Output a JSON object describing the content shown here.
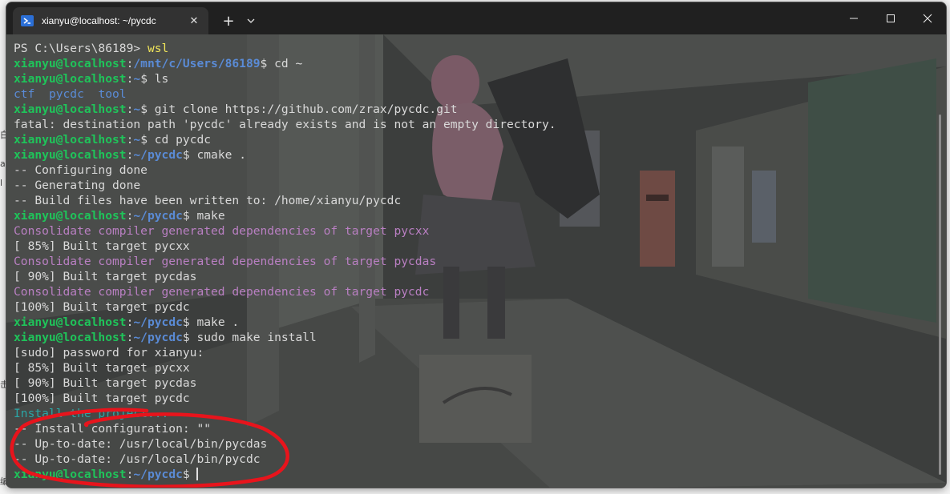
{
  "window": {
    "tab_title": "xianyu@localhost: ~/pycdc",
    "tab_icon": "powershell-icon",
    "close_tab_glyph": "✕",
    "new_tab_glyph": "+",
    "controls": [
      "minimize-icon",
      "maximize-icon",
      "close-icon"
    ]
  },
  "terminal": {
    "prompt_user": "xianyu@localhost",
    "lines": [
      {
        "segs": [
          {
            "t": "PS C:\\Users\\86189> ",
            "c": ""
          },
          {
            "t": "wsl",
            "c": "yellow"
          }
        ]
      },
      {
        "segs": [
          {
            "t": "xianyu@localhost",
            "c": "green"
          },
          {
            "t": ":",
            "c": ""
          },
          {
            "t": "/mnt/c/Users/86189",
            "c": "blue"
          },
          {
            "t": "$ cd ~",
            "c": ""
          }
        ]
      },
      {
        "segs": [
          {
            "t": "xianyu@localhost",
            "c": "green"
          },
          {
            "t": ":",
            "c": ""
          },
          {
            "t": "~",
            "c": "blue"
          },
          {
            "t": "$ ls",
            "c": ""
          }
        ]
      },
      {
        "segs": [
          {
            "t": "ctf",
            "c": "blue-plain"
          },
          {
            "t": "  ",
            "c": ""
          },
          {
            "t": "pycdc",
            "c": "blue-plain"
          },
          {
            "t": "  ",
            "c": ""
          },
          {
            "t": "tool",
            "c": "blue-plain"
          }
        ]
      },
      {
        "segs": [
          {
            "t": "xianyu@localhost",
            "c": "green"
          },
          {
            "t": ":",
            "c": ""
          },
          {
            "t": "~",
            "c": "blue"
          },
          {
            "t": "$ git clone https://github.com/zrax/pycdc.git",
            "c": ""
          }
        ]
      },
      {
        "segs": [
          {
            "t": "fatal: destination path 'pycdc' already exists and is not an empty directory.",
            "c": ""
          }
        ]
      },
      {
        "segs": [
          {
            "t": "xianyu@localhost",
            "c": "green"
          },
          {
            "t": ":",
            "c": ""
          },
          {
            "t": "~",
            "c": "blue"
          },
          {
            "t": "$ cd pycdc",
            "c": ""
          }
        ]
      },
      {
        "segs": [
          {
            "t": "xianyu@localhost",
            "c": "green"
          },
          {
            "t": ":",
            "c": ""
          },
          {
            "t": "~/pycdc",
            "c": "blue"
          },
          {
            "t": "$ cmake .",
            "c": ""
          }
        ]
      },
      {
        "segs": [
          {
            "t": "-- Configuring done",
            "c": ""
          }
        ]
      },
      {
        "segs": [
          {
            "t": "-- Generating done",
            "c": ""
          }
        ]
      },
      {
        "segs": [
          {
            "t": "-- Build files have been written to: /home/xianyu/pycdc",
            "c": ""
          }
        ]
      },
      {
        "segs": [
          {
            "t": "xianyu@localhost",
            "c": "green"
          },
          {
            "t": ":",
            "c": ""
          },
          {
            "t": "~/pycdc",
            "c": "blue"
          },
          {
            "t": "$ make",
            "c": ""
          }
        ]
      },
      {
        "segs": [
          {
            "t": "Consolidate compiler generated dependencies of target pycxx",
            "c": "purple"
          }
        ]
      },
      {
        "segs": [
          {
            "t": "[ 85%] Built target pycxx",
            "c": ""
          }
        ]
      },
      {
        "segs": [
          {
            "t": "Consolidate compiler generated dependencies of target pycdas",
            "c": "purple"
          }
        ]
      },
      {
        "segs": [
          {
            "t": "[ 90%] Built target pycdas",
            "c": ""
          }
        ]
      },
      {
        "segs": [
          {
            "t": "Consolidate compiler generated dependencies of target pycdc",
            "c": "purple"
          }
        ]
      },
      {
        "segs": [
          {
            "t": "[100%] Built target pycdc",
            "c": ""
          }
        ]
      },
      {
        "segs": [
          {
            "t": "xianyu@localhost",
            "c": "green"
          },
          {
            "t": ":",
            "c": ""
          },
          {
            "t": "~/pycdc",
            "c": "blue"
          },
          {
            "t": "$ make .",
            "c": ""
          }
        ]
      },
      {
        "segs": [
          {
            "t": "xianyu@localhost",
            "c": "green"
          },
          {
            "t": ":",
            "c": ""
          },
          {
            "t": "~/pycdc",
            "c": "blue"
          },
          {
            "t": "$ sudo make install",
            "c": ""
          }
        ]
      },
      {
        "segs": [
          {
            "t": "[sudo] password for xianyu:",
            "c": ""
          }
        ]
      },
      {
        "segs": [
          {
            "t": "[ 85%] Built target pycxx",
            "c": ""
          }
        ]
      },
      {
        "segs": [
          {
            "t": "[ 90%] Built target pycdas",
            "c": ""
          }
        ]
      },
      {
        "segs": [
          {
            "t": "[100%] Built target pycdc",
            "c": ""
          }
        ]
      },
      {
        "segs": [
          {
            "t": "Install the project...",
            "c": "teal"
          }
        ]
      },
      {
        "segs": [
          {
            "t": "-- Install configuration: \"\"",
            "c": ""
          }
        ]
      },
      {
        "segs": [
          {
            "t": "-- Up-to-date: /usr/local/bin/pycdas",
            "c": ""
          }
        ]
      },
      {
        "segs": [
          {
            "t": "-- Up-to-date: /usr/local/bin/pycdc",
            "c": ""
          }
        ]
      },
      {
        "segs": [
          {
            "t": "xianyu@localhost",
            "c": "green"
          },
          {
            "t": ":",
            "c": ""
          },
          {
            "t": "~/pycdc",
            "c": "blue"
          },
          {
            "t": "$ ",
            "c": ""
          }
        ],
        "cursor": true
      }
    ]
  },
  "annotation": {
    "color": "#e8141c",
    "shape": "hand-drawn-circle"
  },
  "background_edge_chars": [
    "白",
    "a",
    "l",
    "击",
    "编"
  ]
}
